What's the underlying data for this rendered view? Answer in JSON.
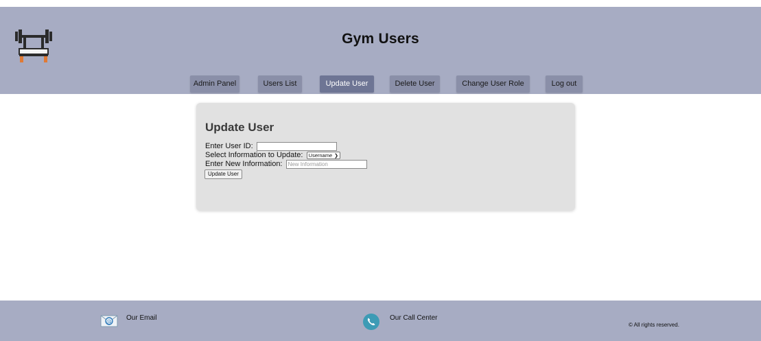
{
  "header": {
    "title": "Gym Users",
    "logo_icon": "barbell-bench-icon"
  },
  "nav": {
    "items": [
      {
        "label": "Admin Panel"
      },
      {
        "label": "Users List"
      },
      {
        "label": "Update User"
      },
      {
        "label": "Delete User"
      },
      {
        "label": "Change User Role"
      },
      {
        "label": "Log out"
      }
    ],
    "active": "Update User"
  },
  "form": {
    "title": "Update User",
    "user_id_label": "Enter User ID:",
    "user_id_value": "",
    "info_label": "Select Information to Update:",
    "info_selected": "Username",
    "new_info_label": "Enter New Information:",
    "new_info_value": "",
    "new_info_placeholder": "New Information",
    "submit_label": "Update User"
  },
  "footer": {
    "email_label": "Our Email",
    "email_icon": "email-icon",
    "call_label": "Our Call Center",
    "call_icon": "phone-icon",
    "copyright": "© All rights reserved."
  },
  "colors": {
    "header_bg": "#a7acc3",
    "nav_button": "#8a8fa8",
    "nav_active": "#6e7594",
    "card_bg": "#e1e1e1",
    "phone_icon": "#3d9bb5"
  }
}
